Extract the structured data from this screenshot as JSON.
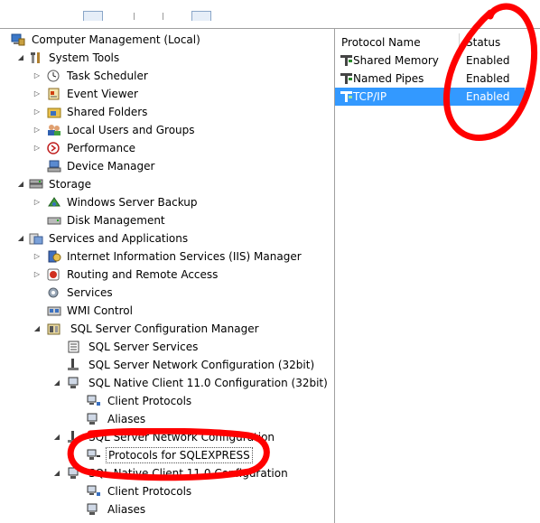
{
  "tree": {
    "items": [
      {
        "label": "Computer Management (Local)",
        "icon": "computer-management-icon"
      },
      {
        "label": "System Tools",
        "icon": "tools-icon"
      },
      {
        "label": "Task Scheduler",
        "icon": "clock-icon"
      },
      {
        "label": "Event Viewer",
        "icon": "event-viewer-icon"
      },
      {
        "label": "Shared Folders",
        "icon": "shared-folders-icon"
      },
      {
        "label": "Local Users and Groups",
        "icon": "users-icon"
      },
      {
        "label": "Performance",
        "icon": "performance-icon"
      },
      {
        "label": "Device Manager",
        "icon": "device-manager-icon"
      },
      {
        "label": "Storage",
        "icon": "storage-icon"
      },
      {
        "label": "Windows Server Backup",
        "icon": "backup-icon"
      },
      {
        "label": "Disk Management",
        "icon": "disk-icon"
      },
      {
        "label": "Services and Applications",
        "icon": "services-apps-icon"
      },
      {
        "label": "Internet Information Services (IIS) Manager",
        "icon": "iis-icon"
      },
      {
        "label": "Routing and Remote Access",
        "icon": "routing-icon"
      },
      {
        "label": "Services",
        "icon": "services-gear-icon"
      },
      {
        "label": "WMI Control",
        "icon": "wmi-icon"
      },
      {
        "label": "SQL Server Configuration Manager",
        "icon": "sql-config-manager-icon"
      },
      {
        "label": "SQL Server Services",
        "icon": "sql-services-icon"
      },
      {
        "label": "SQL Server Network Configuration (32bit)",
        "icon": "network-config-icon"
      },
      {
        "label": "SQL Native Client 11.0 Configuration (32bit)",
        "icon": "native-client-icon"
      },
      {
        "label": "Client Protocols",
        "icon": "client-protocols-icon"
      },
      {
        "label": "Aliases",
        "icon": "aliases-icon"
      },
      {
        "label": "SQL Server Network Configuration",
        "icon": "network-config-icon"
      },
      {
        "label": "Protocols for SQLEXPRESS",
        "icon": "protocols-icon"
      },
      {
        "label": "SQL Native Client 11.0 Configuration",
        "icon": "native-client-icon"
      },
      {
        "label": "Client Protocols",
        "icon": "client-protocols-icon"
      },
      {
        "label": "Aliases",
        "icon": "aliases-icon"
      }
    ]
  },
  "list": {
    "columns": {
      "name": "Protocol Name",
      "status": "Status"
    },
    "rows": [
      {
        "name": "Shared Memory",
        "status": "Enabled",
        "selected": false
      },
      {
        "name": "Named Pipes",
        "status": "Enabled",
        "selected": false
      },
      {
        "name": "TCP/IP",
        "status": "Enabled",
        "selected": true
      }
    ],
    "selection_color": "#3399ff"
  },
  "annotation_color": "#ff0000"
}
